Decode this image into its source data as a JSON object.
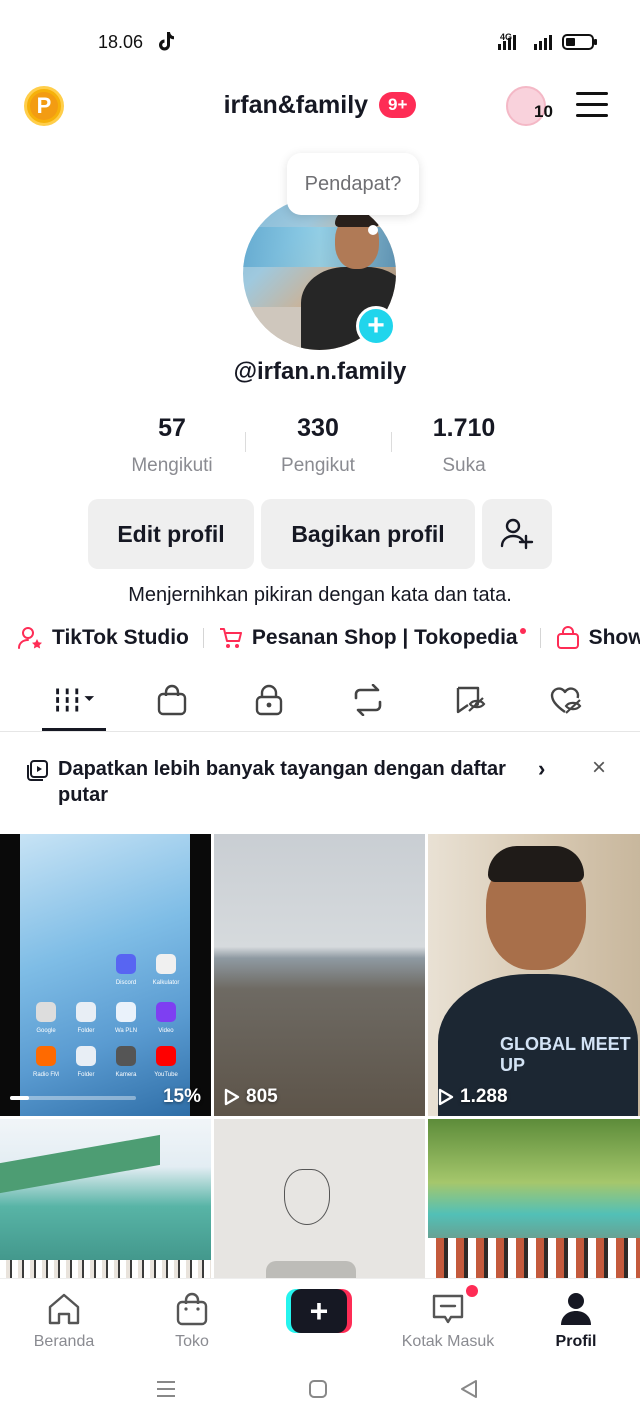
{
  "status_bar": {
    "time": "18.06",
    "network": "4G"
  },
  "header": {
    "account_name": "irfan&family",
    "notification_badge": "9+",
    "visitor_count": "10"
  },
  "profile": {
    "bubble_text": "Pendapat?",
    "username": "@irfan.n.family",
    "stats": [
      {
        "value": "57",
        "label": "Mengikuti"
      },
      {
        "value": "330",
        "label": "Pengikut"
      },
      {
        "value": "1.710",
        "label": "Suka"
      }
    ],
    "buttons": {
      "edit": "Edit profil",
      "share": "Bagikan profil"
    },
    "bio": "Menjernihkan pikiran dengan kata dan tata."
  },
  "links": [
    {
      "label": "TikTok Studio"
    },
    {
      "label": "Pesanan Shop | Tokopedia"
    },
    {
      "label": "Show"
    }
  ],
  "tabs": [
    {
      "icon": "videos-grid-icon",
      "active": true
    },
    {
      "icon": "shop-bag-icon"
    },
    {
      "icon": "lock-icon"
    },
    {
      "icon": "repost-icon"
    },
    {
      "icon": "favorites-icon"
    },
    {
      "icon": "liked-icon"
    }
  ],
  "banner": {
    "text": "Dapatkan lebih banyak tayangan dengan daftar putar",
    "arrow": "›",
    "close": "×"
  },
  "videos": [
    {
      "stat": "15%",
      "progress": 0.15,
      "apps": [
        "Discord",
        "Kalkulator",
        "Google",
        "Folder",
        "Wa PLN",
        "Video",
        "Radio FM",
        "Folder",
        "Kamera",
        "YouTube"
      ]
    },
    {
      "stat": "805"
    },
    {
      "stat": "1.288",
      "shirt_text": "GLOBAL MEET UP"
    },
    {
      "stat": ""
    },
    {
      "stat": ""
    },
    {
      "stat": ""
    }
  ],
  "bottom_nav": [
    {
      "label": "Beranda"
    },
    {
      "label": "Toko"
    },
    {
      "label": "Kotak Masuk"
    },
    {
      "label": "Profil",
      "active": true
    }
  ],
  "colors": {
    "accent_red": "#fe2c55",
    "accent_cyan": "#25f4ee",
    "text_primary": "#161823",
    "text_secondary": "#8a8b91"
  }
}
